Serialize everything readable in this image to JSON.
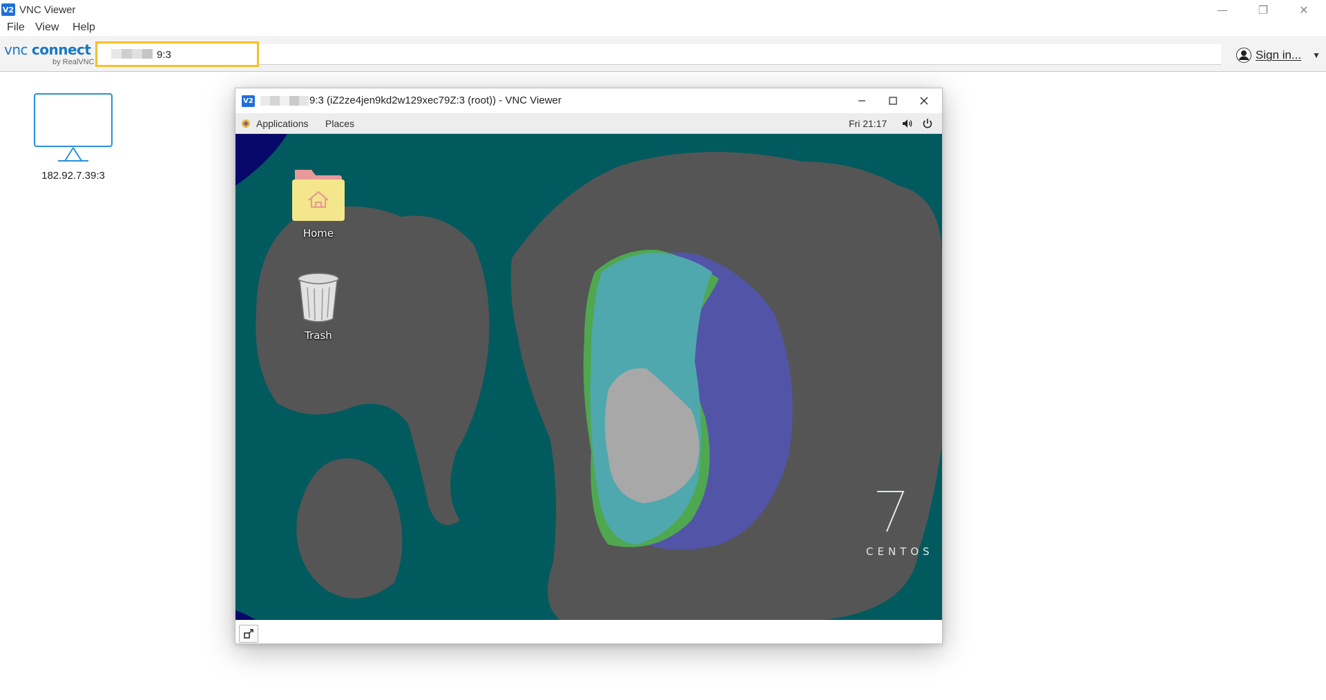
{
  "app": {
    "logo_text": "V2",
    "title": "VNC Viewer",
    "window_controls": {
      "minimize": "—",
      "restore": "❐",
      "close": "✕"
    }
  },
  "menu": {
    "file": "File",
    "view": "View",
    "help": "Help"
  },
  "toolbar": {
    "brand_vnc": "vnc",
    "brand_connect": "connect",
    "brand_by": "by RealVNC",
    "address_value": "9:3",
    "sign_in": "Sign in..."
  },
  "address_book": {
    "entries": [
      {
        "label": "182.92.7.39:3",
        "icon": "monitor-icon"
      }
    ]
  },
  "session": {
    "logo_text": "V2",
    "title": "9:3 (iZ2ze4jen9kd2w129xec79Z:3 (root)) - VNC Viewer",
    "gnome_panel": {
      "applications": "Applications",
      "places": "Places",
      "clock": "Fri 21:17"
    },
    "desktop": {
      "icons": [
        {
          "label": "Home",
          "icon": "home-folder-icon"
        },
        {
          "label": "Trash",
          "icon": "trash-icon"
        }
      ],
      "brand_number": "7",
      "brand_text": "CENTOS"
    }
  },
  "colors": {
    "accent_blue": "#1a78c2",
    "address_highlight": "#f5c02c",
    "desktop_bg": "#005a5e",
    "land_gray": "#555555",
    "eye_teal": "#4fa8ad",
    "eye_purple": "#5254a8",
    "eye_green": "#4fa850"
  }
}
